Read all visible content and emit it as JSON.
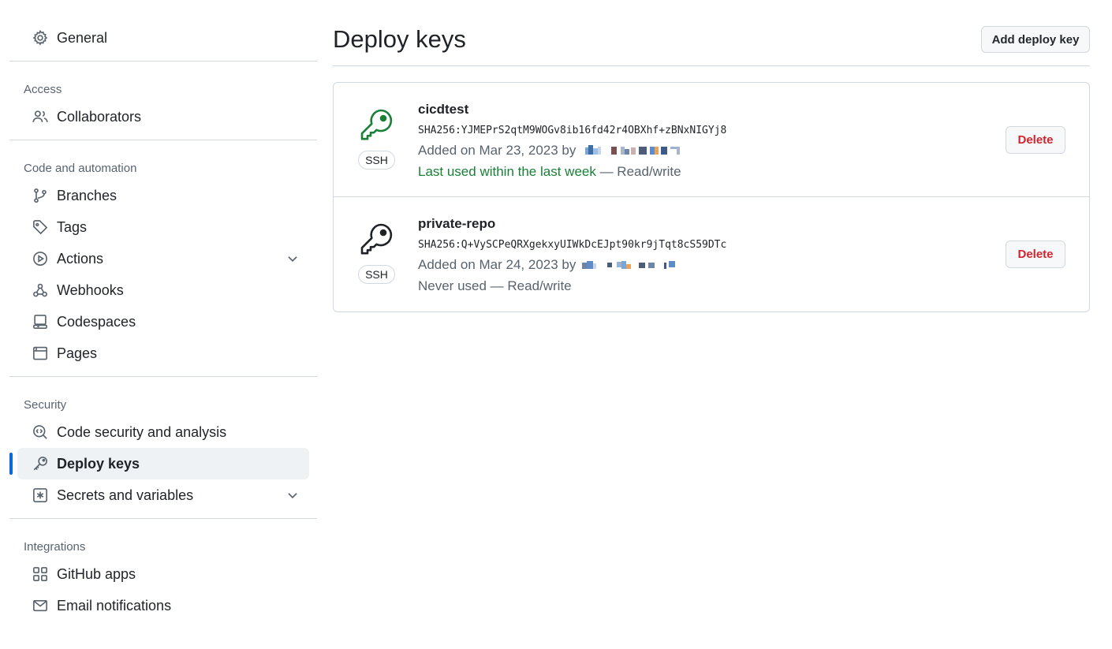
{
  "sidebar": {
    "general": "General",
    "sections": {
      "access": "Access",
      "code_automation": "Code and automation",
      "security": "Security",
      "integrations": "Integrations"
    },
    "items": {
      "collaborators": "Collaborators",
      "branches": "Branches",
      "tags": "Tags",
      "actions": "Actions",
      "webhooks": "Webhooks",
      "codespaces": "Codespaces",
      "pages": "Pages",
      "code_security": "Code security and analysis",
      "deploy_keys": "Deploy keys",
      "secrets": "Secrets and variables",
      "github_apps": "GitHub apps",
      "email_notifications": "Email notifications"
    },
    "active_item": "deploy_keys"
  },
  "main": {
    "title": "Deploy keys",
    "add_button": "Add deploy key",
    "keys": [
      {
        "name": "cicdtest",
        "fingerprint": "SHA256:YJMEPrS2qtM9WOGv8ib16fd42r4OBXhf+zBNxNIGYj8",
        "added": "Added on Mar 23, 2023 by",
        "last_used": "Last used within the last week",
        "access": " — Read/write",
        "badge": "SSH",
        "delete_label": "Delete",
        "icon": "key-icon",
        "icon_color": "#1a7f37"
      },
      {
        "name": "private-repo",
        "fingerprint": "SHA256:Q+VySCPeQRXgekxyUIWkDcEJpt90kr9jTqt8cS59DTc",
        "added": "Added on Mar 24, 2023 by",
        "last_used": "Never used",
        "access": " — Read/write",
        "badge": "SSH",
        "delete_label": "Delete",
        "icon": "key-icon",
        "icon_color": "#1f2328"
      }
    ]
  },
  "colors": {
    "accent": "#0969da",
    "success": "#1a7f37",
    "danger": "#d1242f"
  }
}
